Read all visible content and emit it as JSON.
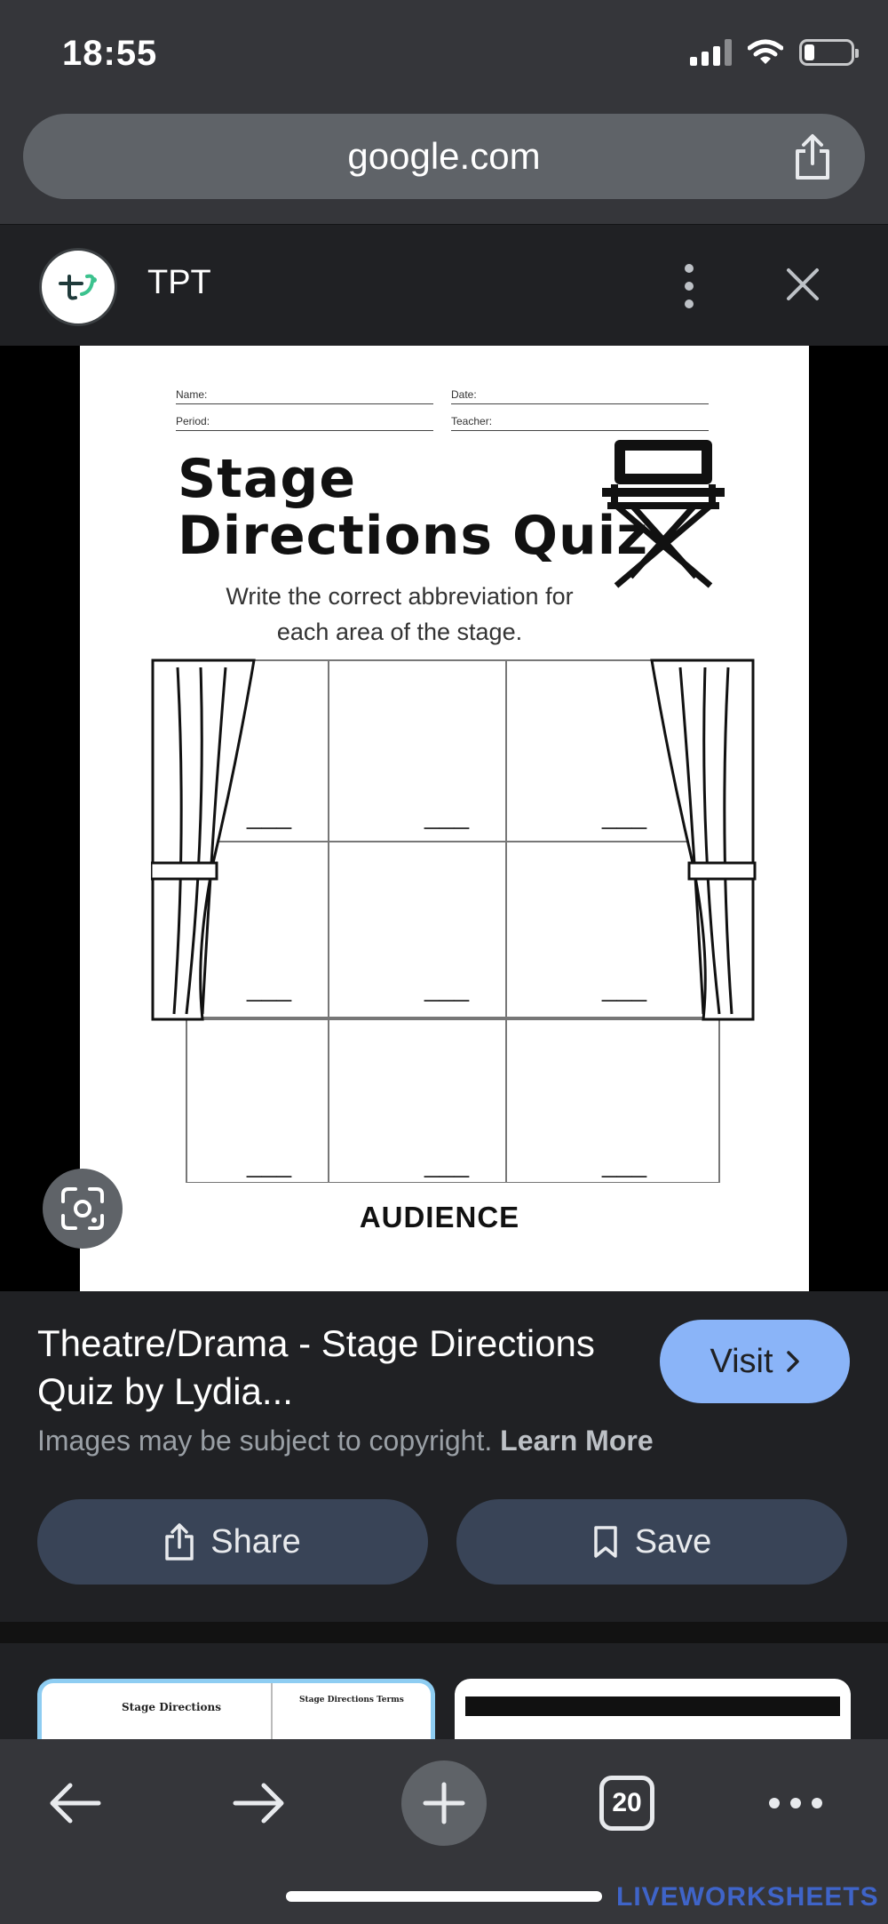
{
  "status_bar": {
    "time": "18:55"
  },
  "browser": {
    "url": "google.com"
  },
  "source": {
    "name": "TPT"
  },
  "preview": {
    "fields": {
      "name": "Name:",
      "date": "Date:",
      "period": "Period:",
      "teacher": "Teacher:"
    },
    "title_line1": "Stage",
    "title_line2": "Directions Quiz",
    "subtitle_line1": "Write the correct abbreviation for",
    "subtitle_line2": "each area of the stage.",
    "blank_marker": "___",
    "audience": "AUDIENCE"
  },
  "result": {
    "title": "Theatre/Drama - Stage Directions Quiz by Lydia...",
    "visit_label": "Visit",
    "copyright_text": "Images may be subject to copyright.",
    "learn_more": "Learn More",
    "share_label": "Share",
    "save_label": "Save"
  },
  "related": [
    {
      "title": "Stage Directions"
    },
    {
      "title": "Stage Directions Terms"
    }
  ],
  "toolbar": {
    "tab_count": "20"
  },
  "watermark": "LIVEWORKSHEETS"
}
